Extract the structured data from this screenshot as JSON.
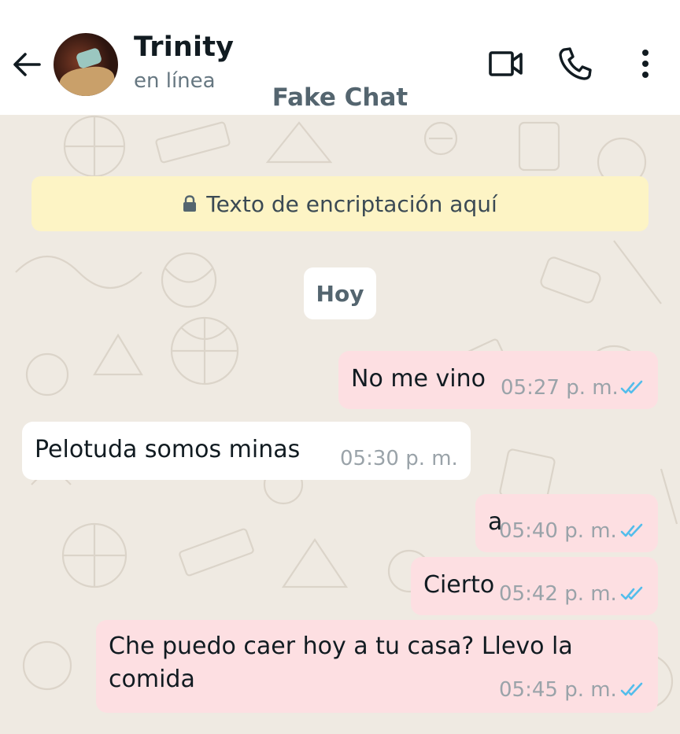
{
  "header": {
    "contact_name": "Trinity",
    "status": "en línea",
    "watermark": "Fake Chat",
    "icons": {
      "back": "arrow-left-icon",
      "video": "video-camera-icon",
      "call": "phone-icon",
      "more": "more-vertical-icon"
    }
  },
  "chat": {
    "encryption_notice": "Texto de encriptación aquí",
    "date_label": "Hoy",
    "messages": [
      {
        "direction": "out",
        "text": "No me vino",
        "time": "05:27 p. m.",
        "read": true
      },
      {
        "direction": "in",
        "text": "Pelotuda somos minas",
        "time": "05:30 p. m."
      },
      {
        "direction": "out",
        "text": "a",
        "time": "05:40 p. m.",
        "read": true
      },
      {
        "direction": "out",
        "text": "Cierto",
        "time": "05:42 p. m.",
        "read": true
      },
      {
        "direction": "out",
        "text_line1": "Che puedo caer hoy a tu casa? Llevo la",
        "text_line2": "comida",
        "time": "05:45 p. m.",
        "read": true
      }
    ]
  },
  "colors": {
    "header_bg": "#ffffff",
    "chat_bg": "#efeae2",
    "outgoing_bubble": "#fddfe2",
    "incoming_bubble": "#ffffff",
    "encryption_bg": "#fdf4c5",
    "read_ticks": "#53bdeb"
  }
}
